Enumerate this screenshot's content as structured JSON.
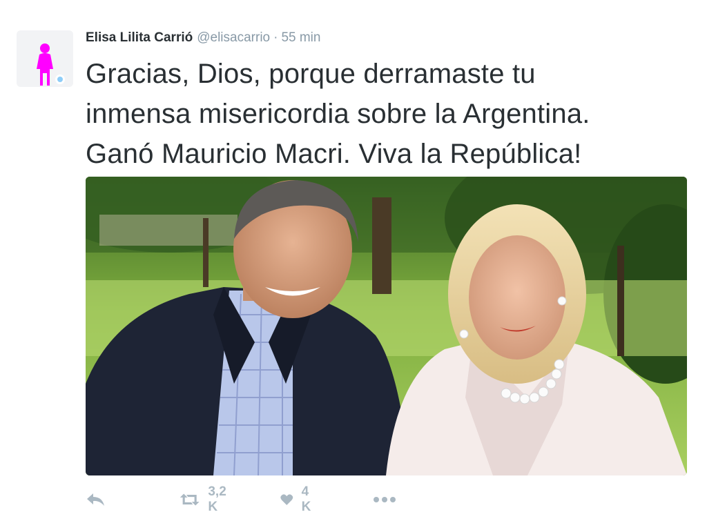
{
  "author": {
    "display_name": "Elisa Lilita Carrió",
    "username": "@elisacarrio",
    "separator": "·",
    "time": "55 min"
  },
  "tweet": {
    "lines": [
      "Gracias, Dios, porque derramaste tu",
      "inmensa misericordia sobre la Argentina.",
      "Ganó Mauricio Macri. Viva la República!"
    ]
  },
  "actions": {
    "reply_icon": "reply-icon",
    "retweet_icon": "retweet-icon",
    "retweet_count": "3,2 K",
    "like_icon": "heart-icon",
    "like_count": "4 K",
    "more_icon": "more-dots-icon"
  },
  "colors": {
    "avatar_figure": "#ff00ff",
    "verified_dot": "#8ecdf8",
    "muted_text": "#8899a6",
    "action_icons": "#aab8c2",
    "body_text": "#292f33"
  }
}
